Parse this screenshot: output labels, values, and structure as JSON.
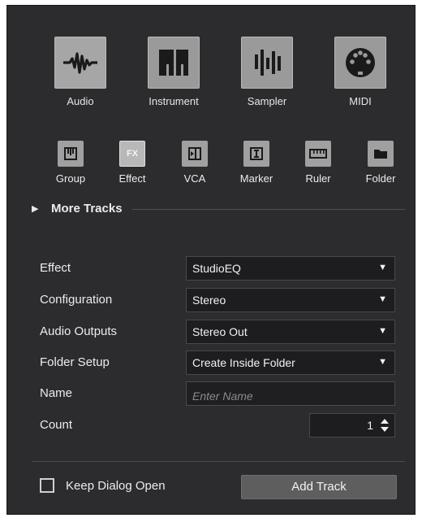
{
  "track_types": [
    {
      "label": "Audio",
      "icon": "audio-waveform-icon"
    },
    {
      "label": "Instrument",
      "icon": "piano-keys-icon"
    },
    {
      "label": "Sampler",
      "icon": "sampler-bars-icon"
    },
    {
      "label": "MIDI",
      "icon": "midi-connector-icon"
    }
  ],
  "small_types": [
    {
      "label": "Group",
      "icon": "group-icon"
    },
    {
      "label": "Effect",
      "icon": "fx-icon",
      "glyph": "FX",
      "active": true
    },
    {
      "label": "VCA",
      "icon": "vca-icon"
    },
    {
      "label": "Marker",
      "icon": "marker-icon"
    },
    {
      "label": "Ruler",
      "icon": "ruler-icon"
    },
    {
      "label": "Folder",
      "icon": "folder-icon"
    }
  ],
  "more_tracks": "More Tracks",
  "form": {
    "effect": {
      "label": "Effect",
      "value": "StudioEQ"
    },
    "configuration": {
      "label": "Configuration",
      "value": "Stereo"
    },
    "audio_outputs": {
      "label": "Audio Outputs",
      "value": "Stereo Out"
    },
    "folder_setup": {
      "label": "Folder Setup",
      "value": "Create Inside Folder"
    },
    "name": {
      "label": "Name",
      "placeholder": "Enter Name",
      "value": ""
    },
    "count": {
      "label": "Count",
      "value": "1"
    }
  },
  "keep_dialog_open": {
    "label": "Keep Dialog Open",
    "checked": false
  },
  "add_track_label": "Add Track",
  "colors": {
    "panel_bg": "#2c2c2e",
    "tile_bg": "#9a9a9a",
    "field_bg": "#1d1d1f",
    "button_bg": "#5e5e5e"
  }
}
